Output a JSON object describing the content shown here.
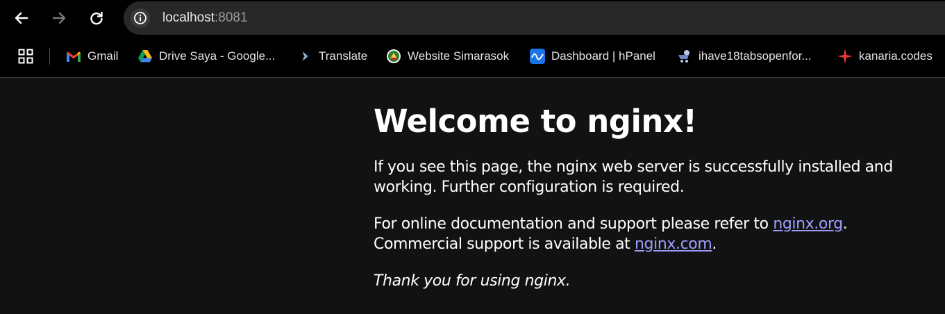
{
  "browser": {
    "address_bar": {
      "host": "localhost",
      "port": ":8081"
    },
    "bookmarks": [
      {
        "label": "Gmail",
        "icon": "gmail-icon"
      },
      {
        "label": "Drive Saya - Google...",
        "icon": "google-drive-icon"
      },
      {
        "label": "Translate",
        "icon": "translate-icon"
      },
      {
        "label": "Website Simarasok",
        "icon": "simarasok-logo-icon"
      },
      {
        "label": "Dashboard | hPanel",
        "icon": "hpanel-icon"
      },
      {
        "label": "ihave18tabsopenfor...",
        "icon": "cart-robot-icon"
      },
      {
        "label": "kanaria.codes",
        "icon": "red-star-icon"
      }
    ]
  },
  "page": {
    "title": "Welcome to nginx!",
    "para1": "If you see this page, the nginx web server is successfully installed and working. Further configuration is required.",
    "para2_prefix": "For online documentation and support please refer to ",
    "link1": "nginx.org",
    "para2_mid": ".",
    "para2_prefix2": "Commercial support is available at ",
    "link2": "nginx.com",
    "para2_end": ".",
    "thanks": "Thank you for using nginx."
  },
  "colors": {
    "page_bg": "#121212",
    "toolbar_bg": "#000000",
    "omnibox_bg": "#282828",
    "link": "#9e9eff"
  }
}
